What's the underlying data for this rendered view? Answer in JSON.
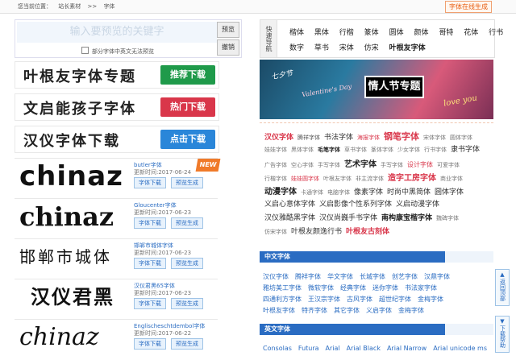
{
  "topbar": {
    "crumb_label": "您当前位置：",
    "crumb_site": "站长素材",
    "crumb_sep": ">>",
    "crumb_page": "字体",
    "gen_button": "字体在线生成"
  },
  "search": {
    "placeholder": "输入要预览的关键字",
    "preview_button": "预览",
    "clear_button": "撤销",
    "hint": "部分字体中英文无法预览"
  },
  "categories": {
    "head": "快速导航",
    "rows": [
      [
        "楷体",
        "黑体",
        "行楷",
        "篆体",
        "圆体",
        "颜体",
        "哥特",
        "花体",
        "行书"
      ],
      [
        "数字",
        "草书",
        "宋体",
        "仿宋",
        "叶根友字体"
      ]
    ]
  },
  "promos": [
    {
      "title": "叶根友字体专题",
      "badge": "推荐下载",
      "color": "#1f9a4a"
    },
    {
      "title": "文启能孩子字体",
      "badge": "热门下载",
      "color": "#d9364a"
    },
    {
      "title": "汉仪字体下载",
      "badge": "点击下载",
      "color": "#2a86d9"
    }
  ],
  "fonts": [
    {
      "preview": "chinaz",
      "name": "butler字体",
      "date": "更新时间:2017-06-24",
      "dl": "字体下载",
      "pv": "预览生成",
      "new": "NEW"
    },
    {
      "preview": "chinaz",
      "name": "Gloucenter字体",
      "date": "更新时间:2017-06-23",
      "dl": "字体下载",
      "pv": "预览生成"
    },
    {
      "preview": "邯郸市城体",
      "name": "邯郸市城体字体",
      "date": "更新时间:2017-06-23",
      "dl": "字体下载",
      "pv": "预览生成"
    },
    {
      "preview": "汉仪君黑",
      "name": "汉仪君黑65字体",
      "date": "更新时间:2017-06-23",
      "dl": "字体下载",
      "pv": "预览生成"
    },
    {
      "preview": "chinaz",
      "name": "Englischeschtdembol字体",
      "date": "更新时间:2017-06-22",
      "dl": "字体下载",
      "pv": "预览生成"
    }
  ],
  "banner": {
    "main": "情人节专题",
    "sub": "七夕节",
    "script1": "Valentine's Day",
    "script2": "love you"
  },
  "tags": [
    [
      {
        "t": "汉仪字体",
        "c": "#d9364a",
        "s": 9,
        "b": true
      },
      {
        "t": "腾祥字体",
        "c": "#555",
        "s": 7
      },
      {
        "t": "书法字体",
        "c": "#333",
        "s": 9
      },
      {
        "t": "海报字体",
        "c": "#d9364a",
        "s": 7
      },
      {
        "t": "钢笔字体",
        "c": "#d9364a",
        "s": 11,
        "b": true
      },
      {
        "t": "宋体字体",
        "c": "#777",
        "s": 7
      },
      {
        "t": "圆体字体",
        "c": "#777",
        "s": 7
      }
    ],
    [
      {
        "t": "娃娃字体",
        "c": "#777",
        "s": 7
      },
      {
        "t": "黑体字体",
        "c": "#777",
        "s": 7
      },
      {
        "t": "毛笔字体",
        "c": "#222",
        "s": 7,
        "b": true
      },
      {
        "t": "草书字体",
        "c": "#777",
        "s": 7
      },
      {
        "t": "篆体字体",
        "c": "#777",
        "s": 7
      },
      {
        "t": "少女字体",
        "c": "#777",
        "s": 7
      },
      {
        "t": "行书字体",
        "c": "#777",
        "s": 7
      },
      {
        "t": "隶书字体",
        "c": "#333",
        "s": 9
      }
    ],
    [
      {
        "t": "广告字体",
        "c": "#777",
        "s": 7
      },
      {
        "t": "空心字体",
        "c": "#777",
        "s": 7
      },
      {
        "t": "手写字体",
        "c": "#777",
        "s": 7
      },
      {
        "t": "艺术字体",
        "c": "#222",
        "s": 10,
        "b": true
      },
      {
        "t": "手写字体",
        "c": "#777",
        "s": 7
      },
      {
        "t": "设计字体",
        "c": "#d9364a",
        "s": 8
      },
      {
        "t": "可爱字体",
        "c": "#777",
        "s": 7
      }
    ],
    [
      {
        "t": "行楷字体",
        "c": "#777",
        "s": 7
      },
      {
        "t": "娃娃圆字体",
        "c": "#d9364a",
        "s": 7
      },
      {
        "t": "叶根友字体",
        "c": "#777",
        "s": 7
      },
      {
        "t": "非主流字体",
        "c": "#777",
        "s": 7
      },
      {
        "t": "造字工房字体",
        "c": "#d9364a",
        "s": 10,
        "b": true
      },
      {
        "t": "商业字体",
        "c": "#777",
        "s": 7
      }
    ],
    [
      {
        "t": "动漫字体",
        "c": "#222",
        "s": 10,
        "b": true
      },
      {
        "t": "卡通字体",
        "c": "#777",
        "s": 7
      },
      {
        "t": "电脑字体",
        "c": "#777",
        "s": 7
      },
      {
        "t": "像素字体",
        "c": "#333",
        "s": 9
      },
      {
        "t": "时尚中黑简体",
        "c": "#333",
        "s": 9
      },
      {
        "t": "圆体字体",
        "c": "#333",
        "s": 9
      }
    ],
    [
      {
        "t": "义启心意体字体",
        "c": "#333",
        "s": 9
      },
      {
        "t": "义启影像个性系列字体",
        "c": "#333",
        "s": 9
      },
      {
        "t": "义启动漫字体",
        "c": "#333",
        "s": 9
      }
    ],
    [
      {
        "t": "汉仪雅酷黑字体",
        "c": "#333",
        "s": 9
      },
      {
        "t": "汉仪尚巍手书字体",
        "c": "#333",
        "s": 9
      },
      {
        "t": "南构康宝楷字体",
        "c": "#222",
        "s": 9,
        "b": true
      },
      {
        "t": "魏碑字体",
        "c": "#777",
        "s": 7
      }
    ],
    [
      {
        "t": "仿宋字体",
        "c": "#777",
        "s": 7
      },
      {
        "t": "叶根友颜逸行书",
        "c": "#333",
        "s": 9
      },
      {
        "t": "叶根友古刻体",
        "c": "#d9364a",
        "s": 9,
        "b": true
      }
    ]
  ],
  "section_cn": "中文字体",
  "cn_fonts": [
    [
      "汉仪字体",
      "腾祥字体",
      "华文字体",
      "长城字体",
      "创艺字体",
      "汉鼎字体"
    ],
    [
      "雅坊美工字体",
      "微软字体",
      "经典字体",
      "迷你字体",
      "书法家字体"
    ],
    [
      "四通利方字体",
      "王汉宗字体",
      "古风字体",
      "超世纪字体",
      "金梅字体"
    ],
    [
      "叶根友字体",
      "特齐字体",
      "其它字体",
      "义启字体",
      "金梅字体"
    ]
  ],
  "section_en": "英文字体",
  "en_fonts": [
    "Consolas",
    "Futura",
    "Arial",
    "Arial Black",
    "Arial Narrow",
    "Arial unicode ms"
  ],
  "tools": {
    "top": "返回顶部",
    "down": "下载帮助"
  }
}
